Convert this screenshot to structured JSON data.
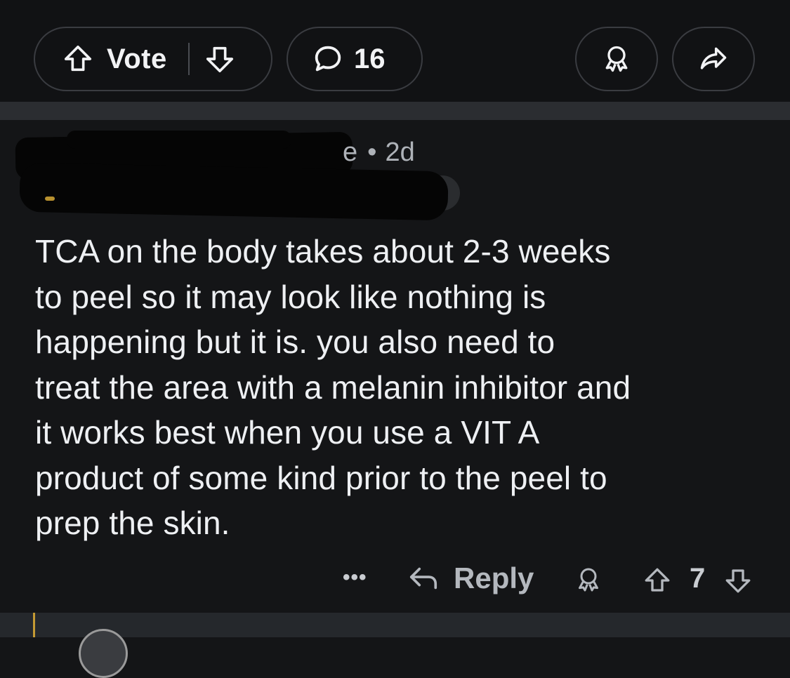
{
  "post_actions": {
    "vote_label": "Vote",
    "comment_count": "16",
    "icons": [
      "upvote-arrow-icon",
      "downvote-arrow-icon",
      "comment-bubble-icon",
      "award-icon",
      "share-arrow-icon"
    ]
  },
  "comment": {
    "author_tail": "e",
    "separator": "•",
    "age": "2d",
    "body": "TCA on the body takes about 2-3 weeks\nto peel so it may look like nothing is\nhappening but it is.  you also need to\ntreat the area with a melanin inhibitor and\nit works best when you use a VIT A\nproduct of some kind prior to the peel to\nprep the skin.",
    "more_label": "•••",
    "reply_label": "Reply",
    "score": "7"
  },
  "colors": {
    "background": "#141517",
    "pill_border": "#3a3c41",
    "separator": "#2b2d31",
    "text": "#eef0f3",
    "muted": "#aeb2b8",
    "thread_line": "#c49a33"
  }
}
